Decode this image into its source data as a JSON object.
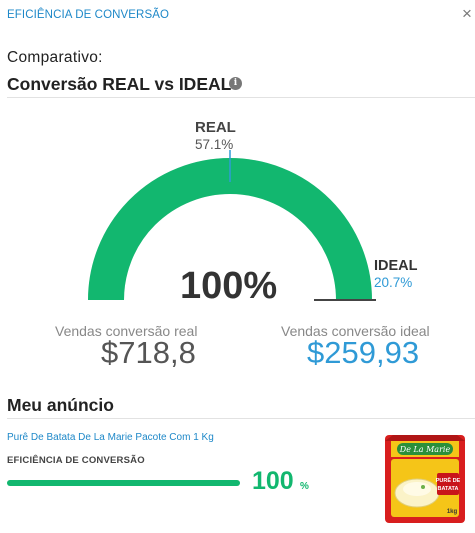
{
  "header": {
    "title": "EFICIÊNCIA DE CONVERSÃO",
    "close_label": "×"
  },
  "section": {
    "pretitle": "Comparativo:",
    "title": "Conversão REAL vs IDEAL",
    "info_icon": "info-icon"
  },
  "gauge": {
    "real_label": "REAL",
    "real_value": "57.1%",
    "ideal_label": "IDEAL",
    "ideal_value": "20.7%",
    "center_value": "100%",
    "fill_fraction": 1.0,
    "ideal_marker_fraction": 1.0,
    "colors": {
      "fill": "#12b76f",
      "marker": "#444444",
      "ideal": "#2f9ad6"
    }
  },
  "sales": {
    "real_label": "Vendas conversão real",
    "real_value": "$718,8",
    "ideal_label": "Vendas conversão ideal",
    "ideal_value": "$259,93"
  },
  "ad": {
    "title": "Meu anúncio",
    "product_name": "Purê De Batata De La Marie Pacote Com 1 Kg",
    "efficiency_label": "EFICIÊNCIA DE CONVERSÃO",
    "efficiency_value": "100",
    "efficiency_unit": "%",
    "efficiency_fraction": 1.0,
    "image": {
      "brand": "De La Marie",
      "line1": "PURÊ DE",
      "line2": "BATATA",
      "weight": "1kg"
    }
  }
}
